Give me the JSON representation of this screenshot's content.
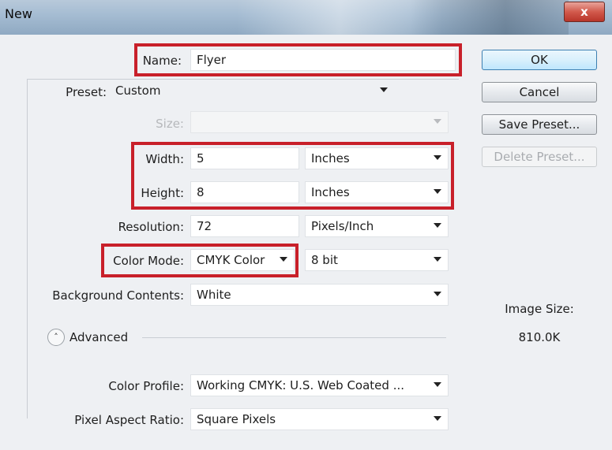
{
  "window": {
    "title": "New",
    "close_label": "x"
  },
  "name_field": {
    "label": "Name:",
    "value": "Flyer"
  },
  "preset": {
    "label": "Preset:",
    "value": "Custom"
  },
  "size": {
    "label": "Size:",
    "value": ""
  },
  "width": {
    "label": "Width:",
    "value": "5",
    "unit": "Inches"
  },
  "height": {
    "label": "Height:",
    "value": "8",
    "unit": "Inches"
  },
  "resolution": {
    "label": "Resolution:",
    "value": "72",
    "unit": "Pixels/Inch"
  },
  "color_mode": {
    "label": "Color Mode:",
    "value": "CMYK Color",
    "depth": "8 bit"
  },
  "background": {
    "label": "Background Contents:",
    "value": "White"
  },
  "advanced": {
    "label": "Advanced"
  },
  "color_profile": {
    "label": "Color Profile:",
    "value": "Working CMYK:  U.S. Web Coated ..."
  },
  "pixel_aspect": {
    "label": "Pixel Aspect Ratio:",
    "value": "Square Pixels"
  },
  "buttons": {
    "ok": "OK",
    "cancel": "Cancel",
    "save_preset": "Save Preset...",
    "delete_preset": "Delete Preset..."
  },
  "image_size": {
    "label": "Image Size:",
    "value": "810.0K"
  },
  "highlight_color": "#c8202a"
}
